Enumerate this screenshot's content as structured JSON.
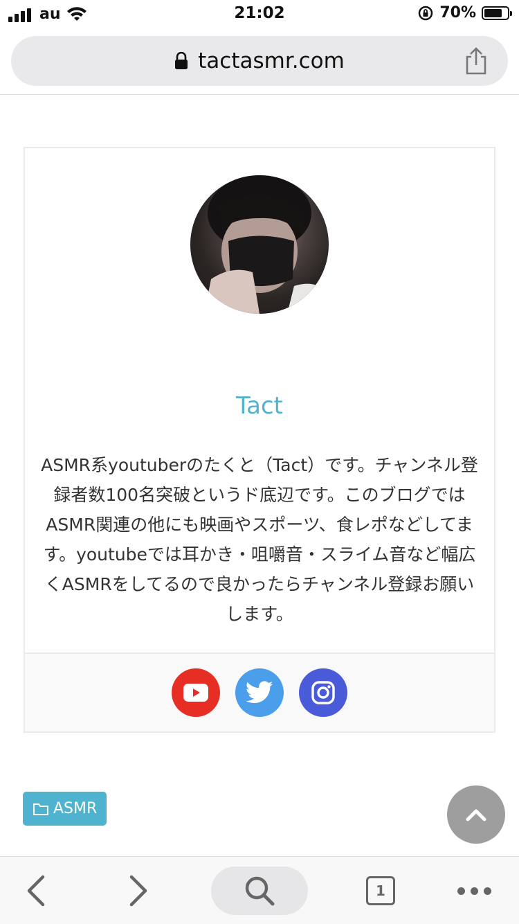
{
  "status_bar": {
    "carrier": "au",
    "time": "21:02",
    "battery_percent": "70%",
    "battery_level": 0.7
  },
  "browser": {
    "url": "tactasmr.com",
    "tab_count": "1"
  },
  "profile": {
    "name": "Tact",
    "bio": "ASMR系youtuberのたくと（Tact）です。チャンネル登録者数100名突破というド底辺です。このブログではASMR関連の他にも映画やスポーツ、食レポなどしてます。youtubeでは耳かき・咀嚼音・スライム音など幅広くASMRをしてるので良かったらチャンネル登録お願いします。",
    "social": [
      {
        "icon": "youtube-icon",
        "color": "#e62e24"
      },
      {
        "icon": "twitter-icon",
        "color": "#4a9eea"
      },
      {
        "icon": "instagram-icon",
        "color": "#4a5bd9"
      }
    ]
  },
  "category": {
    "label": "ASMR",
    "icon": "folder-icon",
    "color": "#4fb3cf"
  },
  "colors": {
    "accent": "#4fb3cf",
    "scroll_button": "#9e9e9e"
  }
}
